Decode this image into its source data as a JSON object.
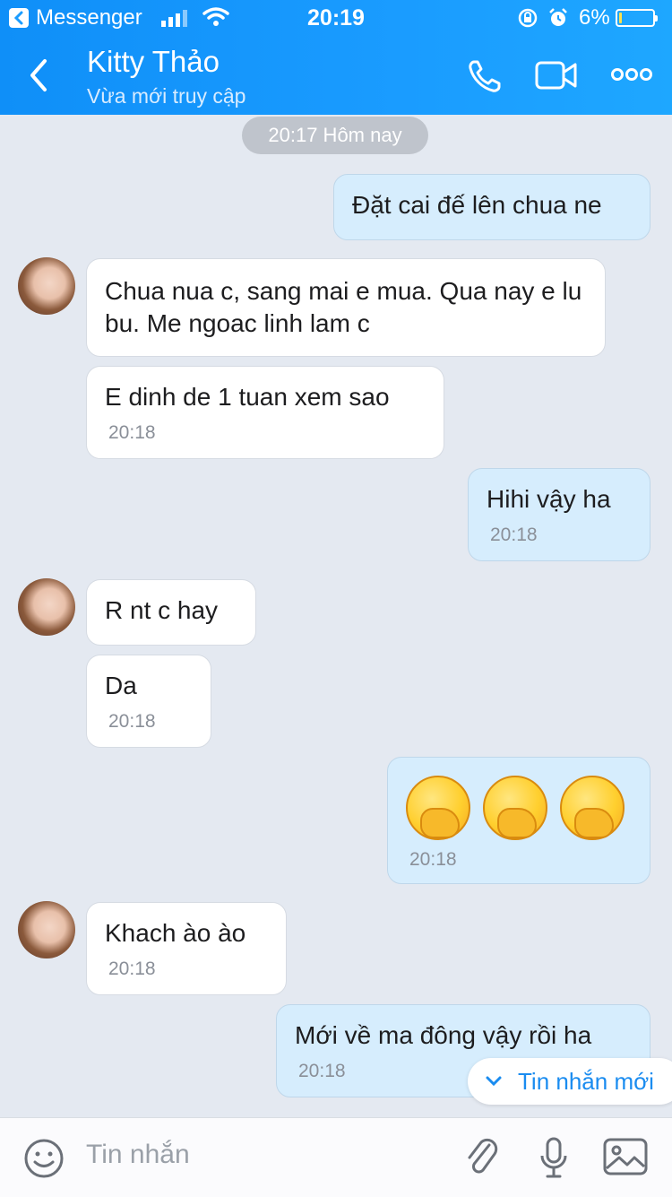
{
  "status_bar": {
    "app": "Messenger",
    "time": "20:19",
    "battery": "6%",
    "battery_level": 0.06
  },
  "header": {
    "name": "Kitty Thảo",
    "status": "Vừa mới truy cập"
  },
  "date_pill": "20:17 Hôm nay",
  "messages": [
    {
      "text": "Đặt cai đế lên chua ne"
    },
    {
      "text": "Chua nua c, sang mai e mua. Qua nay e lu bu. Me ngoac linh lam c"
    },
    {
      "text": "E dinh de 1 tuan xem sao",
      "time": "20:18"
    },
    {
      "text": "Hihi vậy ha",
      "time": "20:18"
    },
    {
      "text": "R nt c hay"
    },
    {
      "text": "Da",
      "time": "20:18"
    },
    {
      "emoji": "hugging-face x3",
      "time": "20:18"
    },
    {
      "text": "Khach ào ào",
      "time": "20:18"
    },
    {
      "text": "Mới về ma đông vậy rồi ha",
      "time": "20:18"
    }
  ],
  "new_messages": "Tin nhắn mới",
  "composer": {
    "placeholder": "Tin nhắn"
  },
  "colors": {
    "header": "#1a9cff",
    "outgoing_bubble": "#d6edfd",
    "incoming_bubble": "#ffffff",
    "background": "#e4e9f1",
    "accent": "#1a8cf0"
  }
}
